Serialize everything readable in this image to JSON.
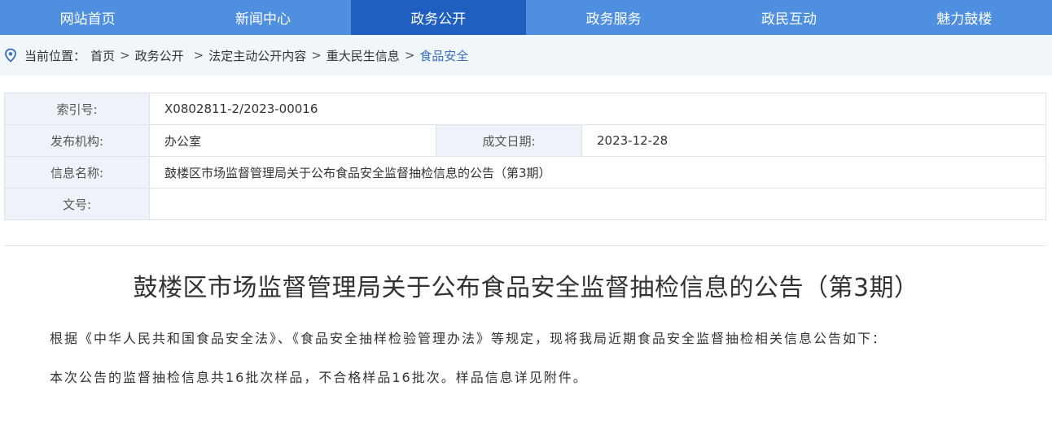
{
  "nav": {
    "items": [
      {
        "label": "网站首页"
      },
      {
        "label": "新闻中心"
      },
      {
        "label": "政务公开"
      },
      {
        "label": "政务服务"
      },
      {
        "label": "政民互动"
      },
      {
        "label": "魅力鼓楼"
      }
    ],
    "active_index": 2
  },
  "breadcrumb": {
    "prefix": "当前位置：",
    "items": [
      "首页",
      "政务公开",
      "法定主动公开内容",
      "重大民生信息"
    ],
    "current": "食品安全",
    "separator": ">"
  },
  "meta": {
    "index_label": "索引号:",
    "index_value": "X0802811-2/2023-00016",
    "org_label": "发布机构:",
    "org_value": "办公室",
    "date_label": "成文日期:",
    "date_value": "2023-12-28",
    "name_label": "信息名称:",
    "name_value": "鼓楼区市场监督管理局关于公布食品安全监督抽检信息的公告（第3期）",
    "doc_label": "文号:",
    "doc_value": ""
  },
  "article": {
    "title": "鼓楼区市场监督管理局关于公布食品安全监督抽检信息的公告（第3期）",
    "paragraphs": [
      "根据《中华人民共和国食品安全法》、《食品安全抽样检验管理办法》等规定，现将我局近期食品安全监督抽检相关信息公告如下：",
      "本次公告的监督抽检信息共16批次样品，不合格样品16批次。样品信息详见附件。"
    ]
  },
  "colors": {
    "nav_bg": "#4f8fdf",
    "nav_active": "#1e5fc0",
    "crumb_bg": "#f1f6fb",
    "label_bg": "#eef3f9",
    "accent": "#3a6fb8"
  },
  "icons": {
    "location": "location-pin-icon"
  }
}
